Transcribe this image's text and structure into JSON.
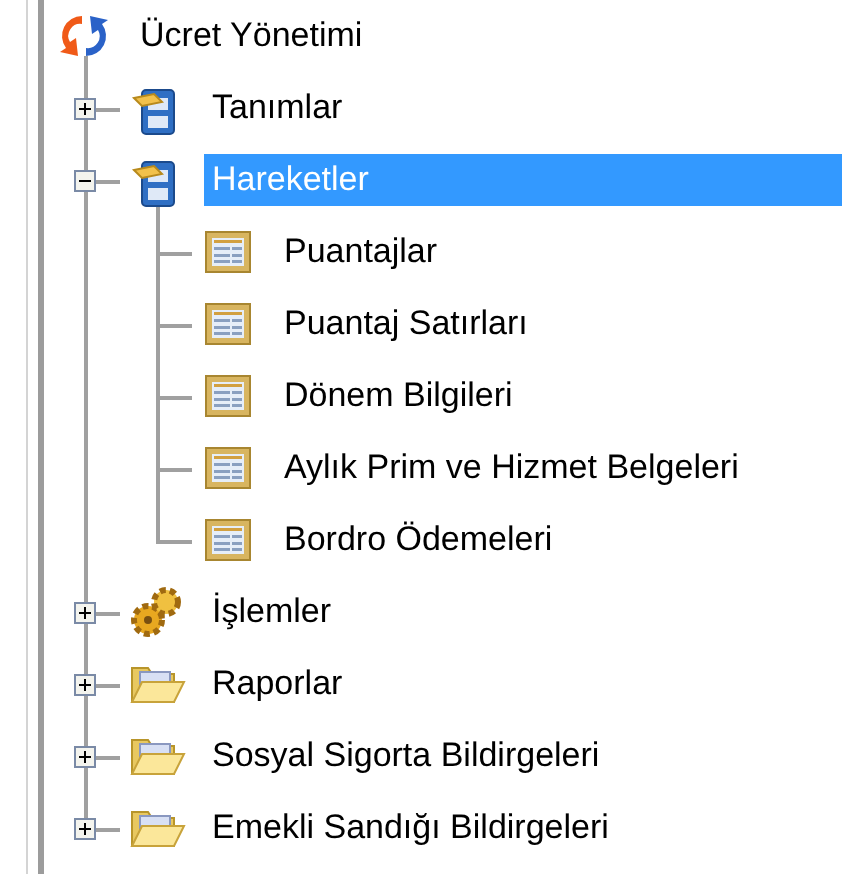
{
  "tree": {
    "label": "Ücret Yönetimi",
    "kind": "app",
    "selected": false,
    "children": [
      {
        "label": "Tanımlar",
        "kind": "cabinet",
        "expanded": false,
        "selected": false
      },
      {
        "label": "Hareketler",
        "kind": "cabinet",
        "expanded": true,
        "selected": true,
        "children": [
          {
            "label": "Puantajlar",
            "kind": "table",
            "selected": false
          },
          {
            "label": "Puantaj Satırları",
            "kind": "table",
            "selected": false
          },
          {
            "label": "Dönem Bilgileri",
            "kind": "table",
            "selected": false
          },
          {
            "label": "Aylık Prim ve Hizmet Belgeleri",
            "kind": "table",
            "selected": false
          },
          {
            "label": "Bordro Ödemeleri",
            "kind": "table",
            "selected": false
          }
        ]
      },
      {
        "label": "İşlemler",
        "kind": "gears",
        "expanded": false,
        "selected": false
      },
      {
        "label": "Raporlar",
        "kind": "folder",
        "expanded": false,
        "selected": false
      },
      {
        "label": "Sosyal Sigorta Bildirgeleri",
        "kind": "folder",
        "expanded": false,
        "selected": false
      },
      {
        "label": "Emekli Sandığı Bildirgeleri",
        "kind": "folder",
        "expanded": false,
        "selected": false
      }
    ]
  }
}
